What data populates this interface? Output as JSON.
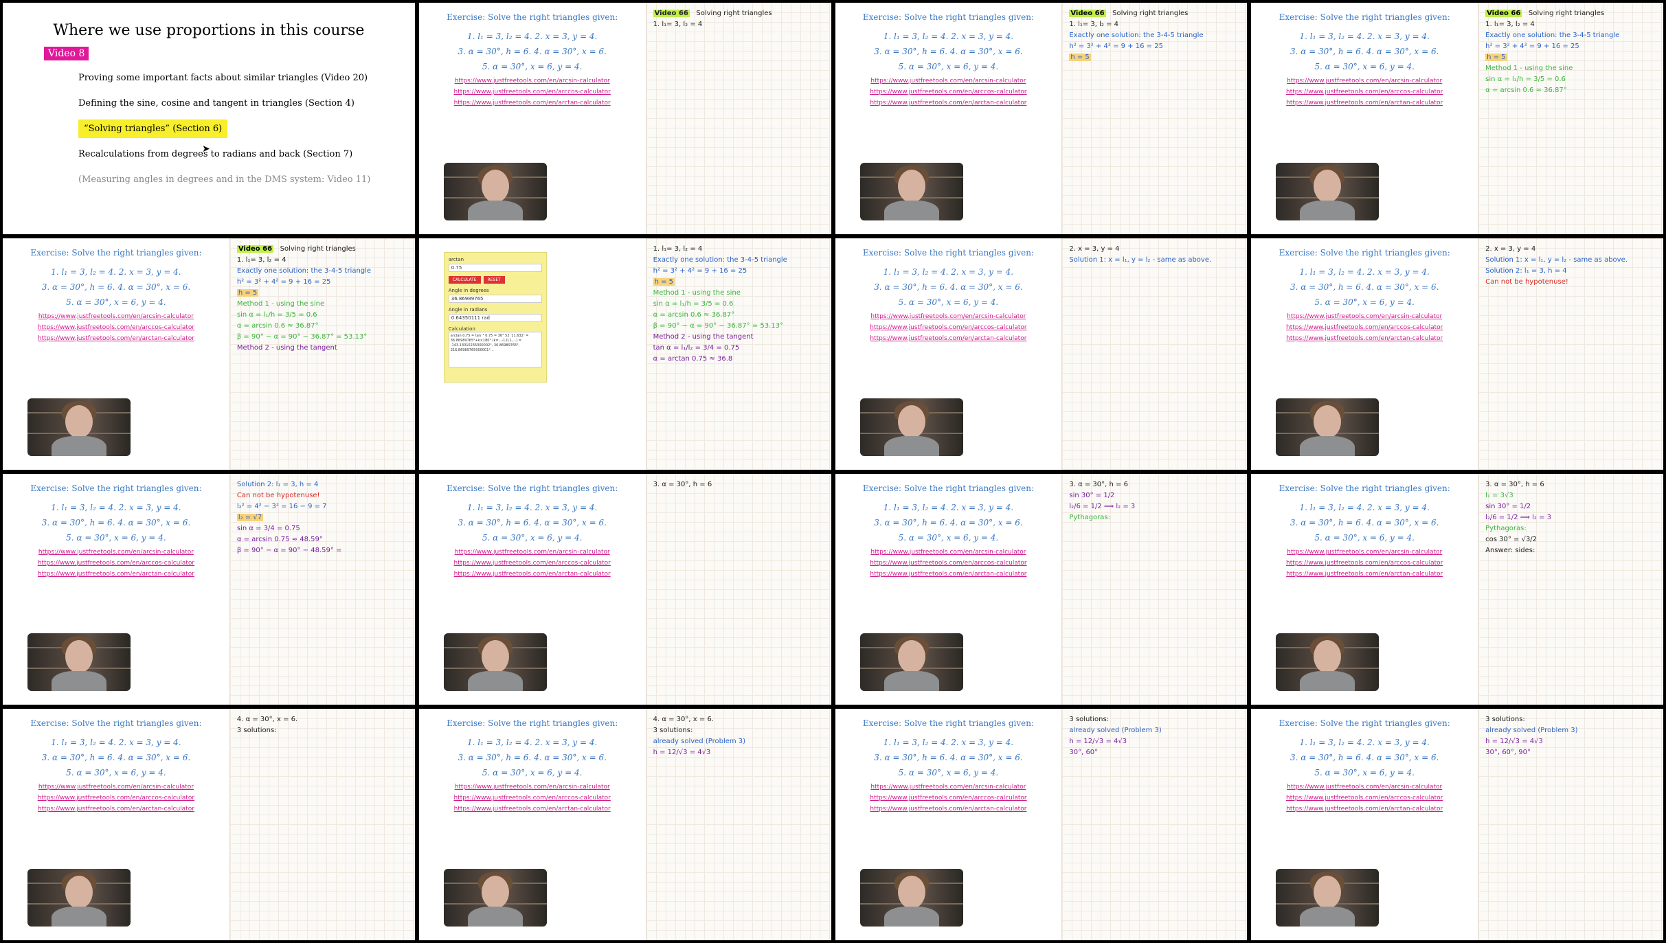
{
  "intro": {
    "title": "Where we use proportions in this course",
    "badge": "Video 8",
    "items": [
      "Proving some important facts about similar triangles (Video 20)",
      "Defining the sine, cosine and tangent in triangles (Section 4)",
      "“Solving triangles” (Section 6)",
      "Recalculations from degrees to radians and back (Section 7)",
      "(Measuring angles in degrees and in the DMS system: Video 11)"
    ]
  },
  "exercise": {
    "title": "Exercise: Solve the right triangles given:",
    "line1": "1.  l₁ = 3, l₂ = 4.     2.  x = 3, y = 4.",
    "line2": "3.  α = 30°, h = 6.     4.  α = 30°, x = 6.",
    "line3": "5.  α = 30°, x = 6, y = 4.",
    "links": [
      "https://www.justfreetools.com/en/arcsin-calculator",
      "https://www.justfreetools.com/en/arccos-calculator",
      "https://www.justfreetools.com/en/arctan-calculator"
    ]
  },
  "notes": {
    "video_tag": "Video 66",
    "heading": "Solving right triangles",
    "p1": "1.   l₁= 3,   l₂ = 4",
    "p1_sol": "Exactly one solution: the 3-4-5 triangle",
    "p1_eq": "h² = 3² + 4² = 9 + 16 = 25",
    "p1_h": "h = 5",
    "m1": "Method 1 - using the sine",
    "m1_eq": "sin α = l₁/h = 3/5 = 0.6",
    "m1_alpha": "α = arcsin 0.6 ≈ 36.87°",
    "m1_beta": "β = 90° − α = 90° − 36.87° = 53.13°",
    "m2": "Method 2 - using the tangent",
    "m2_eq": "tan α = l₁/l₂ = 3/4 = 0.75",
    "m2_alpha": "α = arctan 0.75 ≈ 36.8",
    "p2": "2.   x = 3,   y = 4",
    "p2_s1": "Solution 1:  x = l₁, y = l₂ - same as above.",
    "p2_s2": "Solution 2:  l₁ = 3,  h = 4",
    "p2_no": "Can not be hypotenuse!",
    "p2_eq": "l₂² = 4² − 3² = 16 − 9 = 7",
    "p2_l2": "l₂ = √7",
    "p2_sin": "sin α = 3/4 = 0.75",
    "p2_alpha": "α = arcsin 0.75 ≈ 48.59°",
    "p2_beta": "β = 90° − α = 90° − 48.59° =",
    "p3": "3.   α = 30°,   h = 6",
    "p3_sin": "sin 30° = 1/2",
    "p3_eq": "l₂/6 = 1/2  ⟹  l₂ = 3",
    "p3_py": "Pythagoras:",
    "p3_l1": "l₁ = 3√3",
    "p3_cos": "cos 30° = √3/2",
    "p3_ans": "Answer:  sides:",
    "p4": "4.   α = 30°,   x = 6.",
    "p4_sol": "3 solutions:",
    "p4_done": "already solved (Problem 3)",
    "p4_h": "h = 12/√3 = 4√3",
    "p4_ans": "30°, 60°",
    "p4_ans2": "30°, 60°, 90°"
  },
  "calculator": {
    "label": "arctan",
    "value": "0.75",
    "calc_btn": "CALCULATE",
    "reset_btn": "RESET",
    "deg_label": "Angle in degrees",
    "deg_value": "36.86989765",
    "rad_label": "Angle in radians",
    "rad_value": "0.64350111",
    "rad_unit": "rad",
    "calc_label": "Calculation",
    "calc_text": "arctan 0.75 = tan⁻¹ 0.75 = 36° 52′ 11.632″ = 36.86989765°+k×180° (k=...-1,0,1,...) = -143.13010235000002°, 36.86989765°, 216.86989765000001°..."
  }
}
